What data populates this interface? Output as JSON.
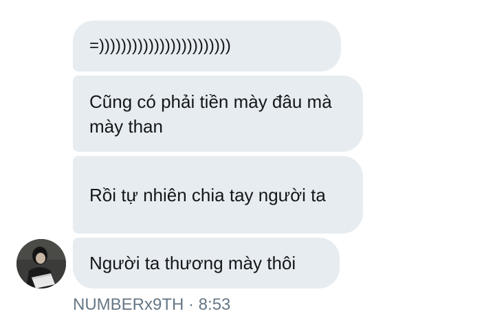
{
  "messages": [
    {
      "text": "=))))))))))))))))))))))))"
    },
    {
      "text": "Cũng có phải tiền mày đâu mà mày than"
    },
    {
      "text": "Rồi tự nhiên chia tay người ta"
    },
    {
      "text": "Người ta thương mày thôi"
    }
  ],
  "sender": {
    "name": "NUMBERx9TH",
    "separator": " · ",
    "time": "8:53"
  },
  "colors": {
    "bubble_bg": "#e6ecf0",
    "message_text": "#14171a",
    "meta_text": "#657786"
  },
  "icons": {
    "avatar": "profile-photo"
  }
}
